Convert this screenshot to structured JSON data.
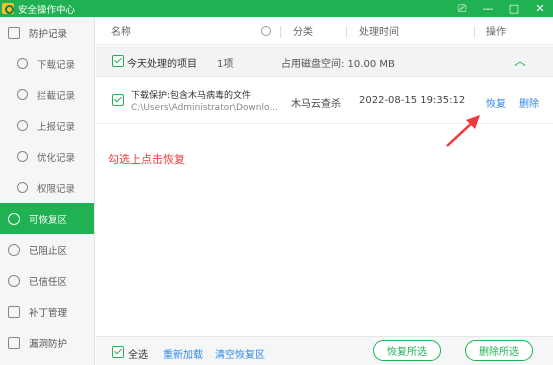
{
  "window": {
    "title": "安全操作中心",
    "controls": [
      "⎚",
      "—",
      "□",
      "✕"
    ]
  },
  "sidebar": {
    "items": [
      {
        "label": "防护记录",
        "icon": "shield-record-icon"
      },
      {
        "label": "下载记录",
        "icon": "download-icon"
      },
      {
        "label": "拦截记录",
        "icon": "block-icon"
      },
      {
        "label": "上报记录",
        "icon": "upload-icon"
      },
      {
        "label": "优化记录",
        "icon": "optimize-icon"
      },
      {
        "label": "权限记录",
        "icon": "permission-icon"
      },
      {
        "label": "可恢复区",
        "icon": "restore-icon"
      },
      {
        "label": "已阻止区",
        "icon": "blocked-icon"
      },
      {
        "label": "已信任区",
        "icon": "trust-icon"
      },
      {
        "label": "补丁管理",
        "icon": "patch-icon"
      },
      {
        "label": "漏洞防护",
        "icon": "vulnerability-icon"
      }
    ]
  },
  "table": {
    "headers": {
      "name": "名称",
      "category": "分类",
      "time": "处理时间",
      "op": "操作"
    },
    "group": {
      "label": "今天处理的项目",
      "count": "1项",
      "disk": "占用磁盘空间: 10.00 MB"
    },
    "row": {
      "title": "下载保护:包含木马病毒的文件",
      "path": "C:\\Users\\Administrator\\Downlo...",
      "category": "木马云查杀",
      "time": "2022-08-15 19:35:12",
      "restore": "恢复",
      "delete": "删除"
    }
  },
  "annotation": {
    "text": "勾选上点击恢复"
  },
  "footer": {
    "select_all": "全选",
    "reload": "重新加载",
    "clear": "清空恢复区",
    "restore_selected": "恢复所选",
    "delete_selected": "删除所选"
  },
  "colors": {
    "brand": "#1fb152",
    "accent_blue": "#2f89ea",
    "note_red": "#ef3a3a"
  }
}
